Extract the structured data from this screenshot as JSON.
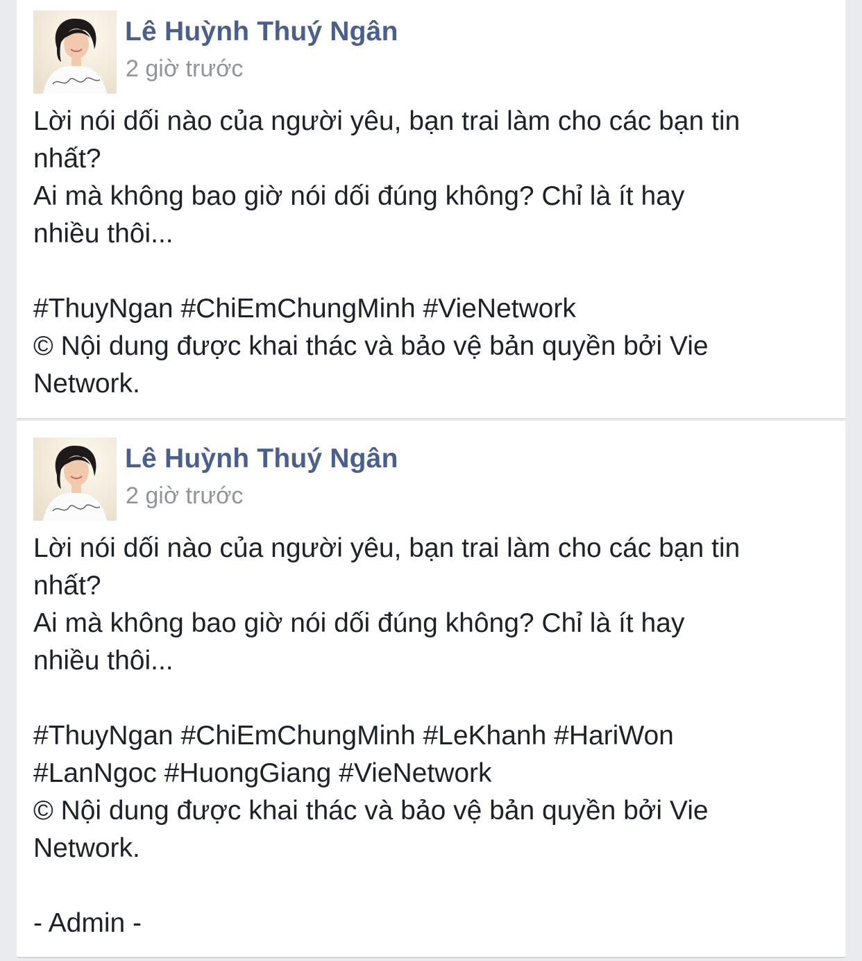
{
  "posts": [
    {
      "author": "Lê Huỳnh Thuý Ngân",
      "time": "2 giờ trước",
      "avatar_icon": "profile-photo-woman",
      "lines": [
        "Lời nói dối nào của người yêu, bạn trai làm cho các bạn tin",
        "nhất?",
        "Ai mà không bao giờ nói dối đúng không? Chỉ là ít hay",
        "nhiều thôi...",
        "",
        "#ThuyNgan #ChiEmChungMinh #VieNetwork",
        "© Nội dung được khai thác và bảo vệ bản quyền bởi Vie",
        "Network."
      ]
    },
    {
      "author": "Lê Huỳnh Thuý Ngân",
      "time": "2 giờ trước",
      "avatar_icon": "profile-photo-woman",
      "lines": [
        "Lời nói dối nào của người yêu, bạn trai làm cho các bạn tin",
        "nhất?",
        "Ai mà không bao giờ nói dối đúng không? Chỉ là ít hay",
        "nhiều thôi...",
        "",
        "#ThuyNgan #ChiEmChungMinh #LeKhanh #HariWon",
        "#LanNgoc #HuongGiang #VieNetwork",
        "© Nội dung được khai thác và bảo vệ bản quyền bởi Vie",
        "Network.",
        "",
        "- Admin -"
      ]
    }
  ],
  "colors": {
    "author": "#4b5f8d",
    "time": "#90949c",
    "text": "#1d2129",
    "background": "#e9ebee",
    "card": "#ffffff"
  }
}
